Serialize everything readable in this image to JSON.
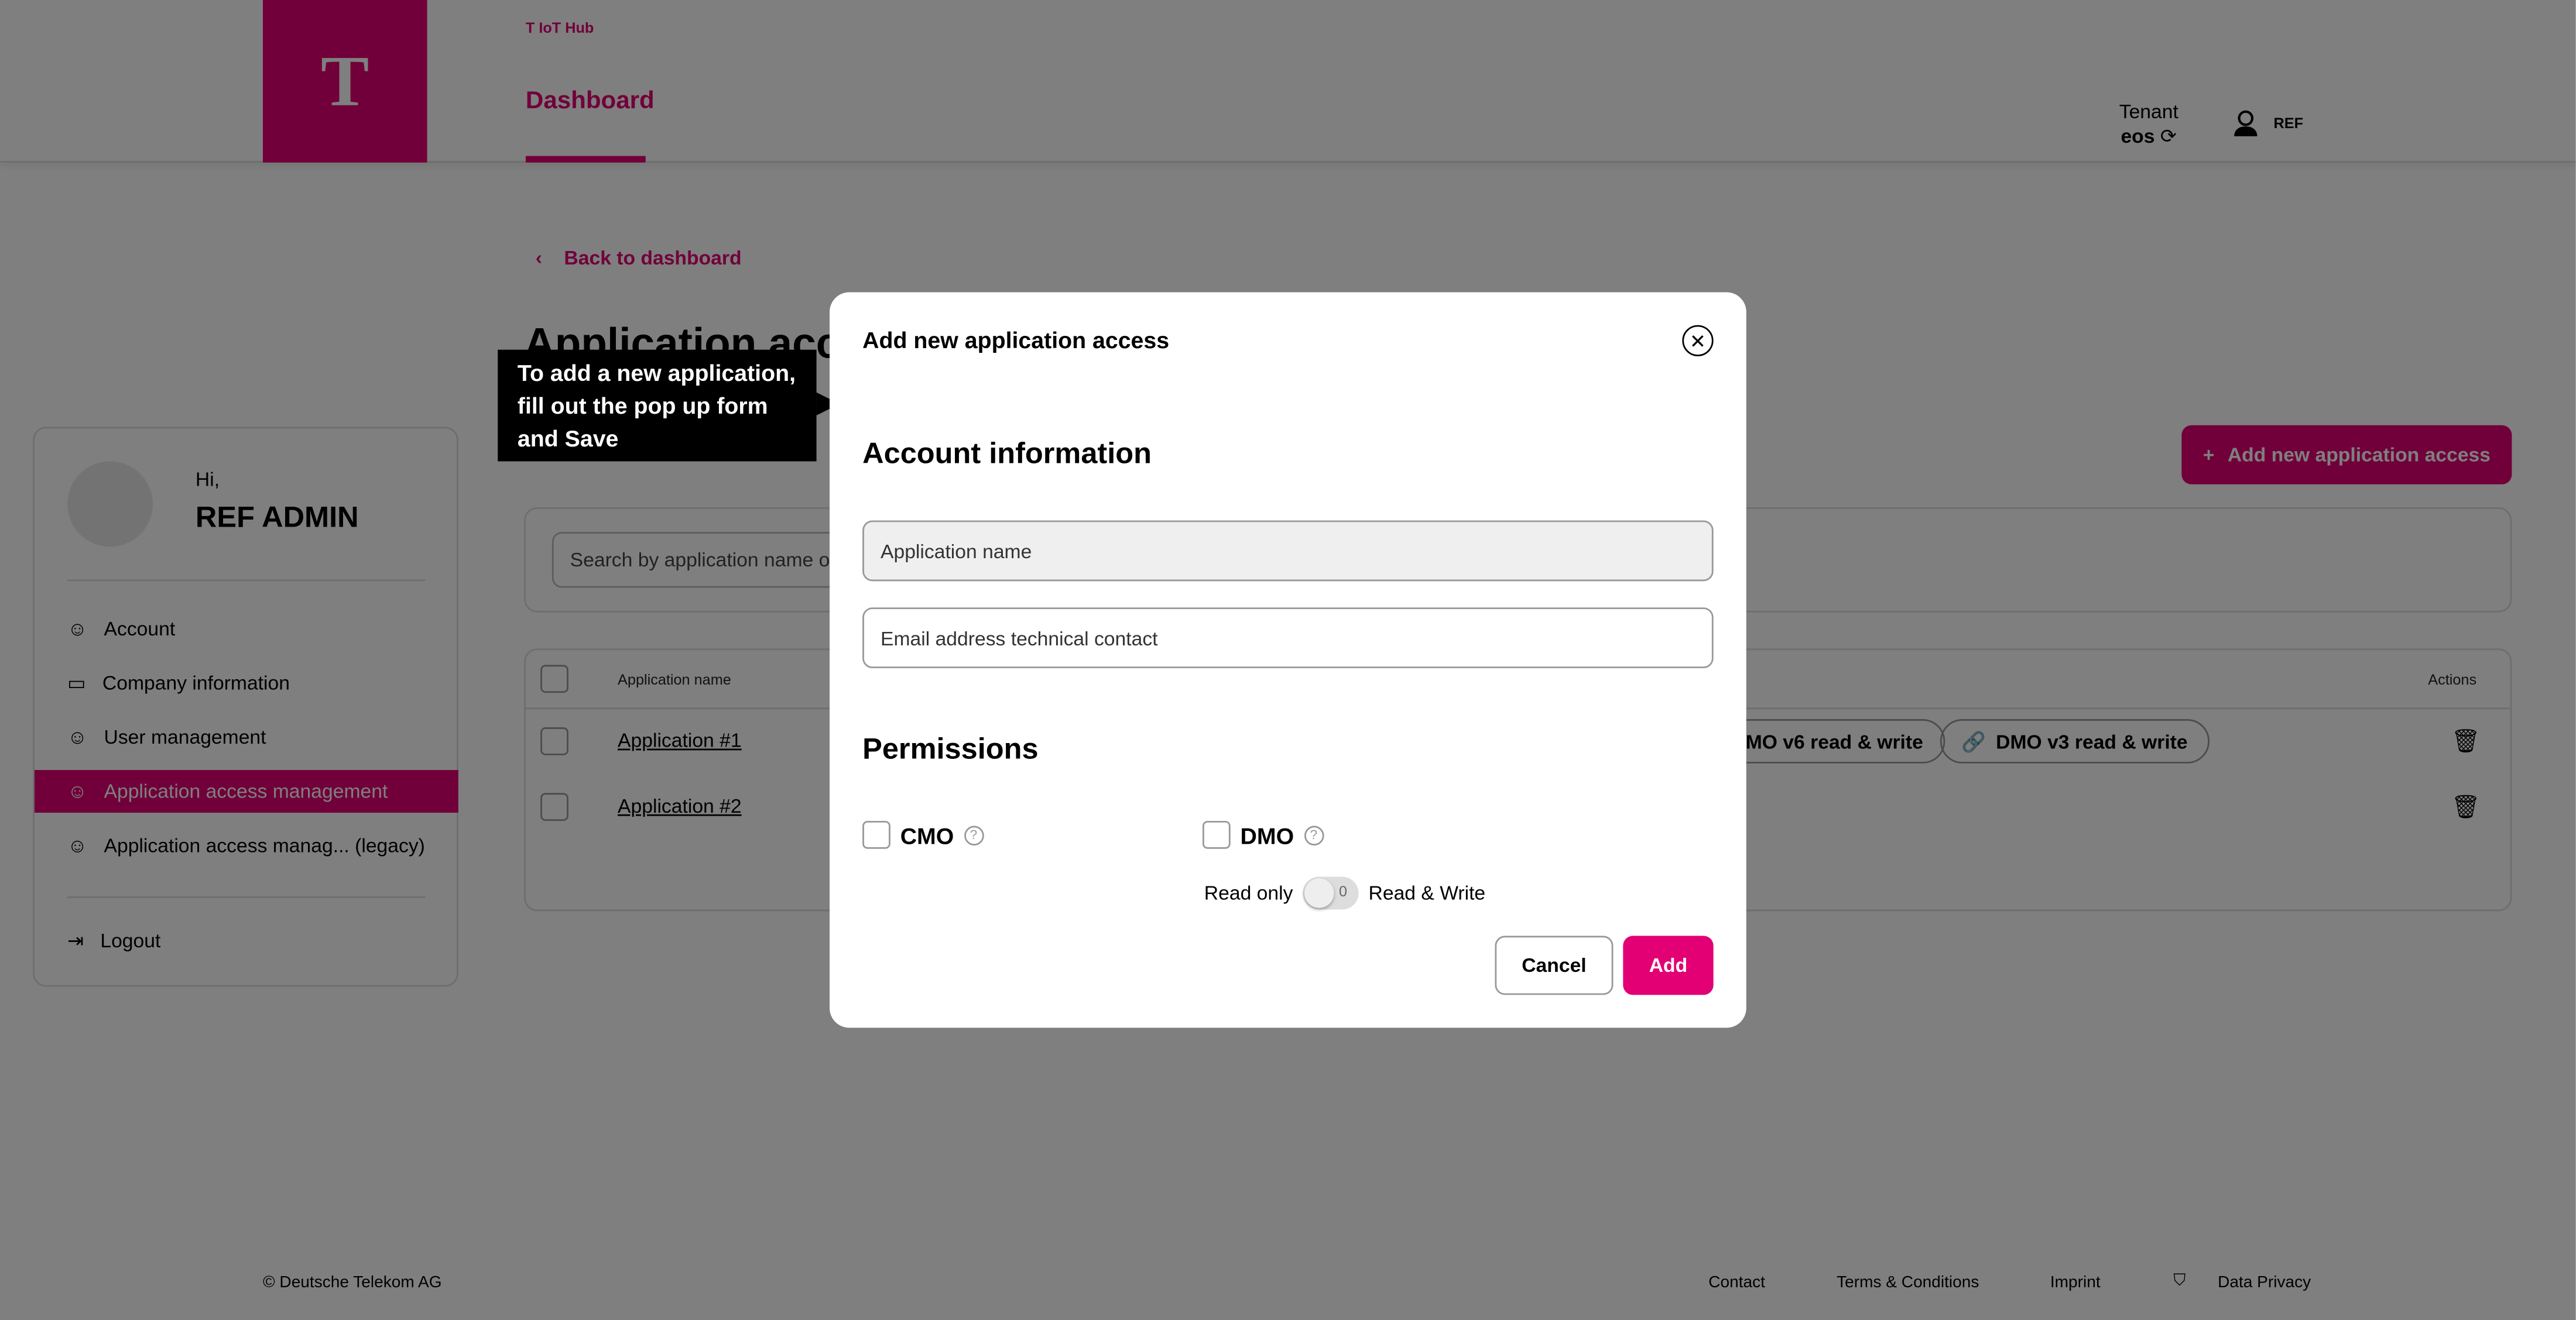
{
  "header": {
    "brand": "T IoT Hub",
    "logo": "T",
    "nav_dashboard": "Dashboard",
    "tenant_label": "Tenant",
    "tenant_value": "eos",
    "user": "REF"
  },
  "page": {
    "back": "Back to dashboard",
    "title": "Application access management",
    "add_button": "Add new application access",
    "search_placeholder": "Search by application name or email"
  },
  "sidebar": {
    "greeting": "Hi,",
    "name": "REF ADMIN",
    "items": [
      {
        "label": "Account",
        "icon": "user-icon"
      },
      {
        "label": "Company information",
        "icon": "briefcase-icon"
      },
      {
        "label": "User management",
        "icon": "users-icon"
      },
      {
        "label": "Application access management",
        "icon": "app-access-icon",
        "active": true
      },
      {
        "label": "Application access manag... (legacy)",
        "icon": "app-access-legacy-icon"
      }
    ],
    "logout": "Logout"
  },
  "table": {
    "headers": {
      "name": "Application name",
      "actions": "Actions"
    },
    "rows": [
      {
        "name": "Application #1",
        "chips": [
          "DMO v6 read & write",
          "DMO v3 read & write"
        ]
      },
      {
        "name": "Application #2",
        "chips": []
      }
    ]
  },
  "footer": {
    "copyright": "© Deutsche Telekom AG",
    "links": [
      "Contact",
      "Terms & Conditions",
      "Imprint",
      "Data Privacy"
    ]
  },
  "tooltip": {
    "text": "To add a new application, fill out the pop up form and Save"
  },
  "modal": {
    "title": "Add new application access",
    "section_account": "Account information",
    "app_name_placeholder": "Application name",
    "email_placeholder": "Email address technical contact",
    "section_permissions": "Permissions",
    "cmo": "CMO",
    "dmo": "DMO",
    "read_only": "Read only",
    "read_write": "Read & Write",
    "toggle_value": "0",
    "cancel": "Cancel",
    "add": "Add"
  },
  "colors": {
    "brand": "#e20074"
  }
}
